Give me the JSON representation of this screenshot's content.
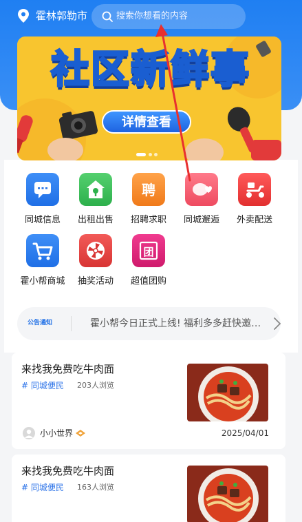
{
  "header": {
    "city": "霍林郭勒市",
    "search_placeholder": "搜索你想看的内容"
  },
  "banner": {
    "title": "社区新鲜事",
    "button_label": "详情查看",
    "colors": {
      "background": "#f8c52f",
      "title_fill": "#e6f1ff",
      "title_stroke": "#1a5ed1",
      "button": "#2f7af0"
    }
  },
  "categories": [
    {
      "label": "同城信息",
      "icon": "chat-bubble-icon",
      "color": "#2d7df0"
    },
    {
      "label": "出租出售",
      "icon": "house-icon",
      "color": "#39c15a"
    },
    {
      "label": "招聘求职",
      "icon": "hire-icon",
      "color": "#f58a2c"
    },
    {
      "label": "同城邂逅",
      "icon": "heart-chat-icon",
      "color": "#f15b6c"
    },
    {
      "label": "外卖配送",
      "icon": "scooter-icon",
      "color": "#ef3b3b"
    },
    {
      "label": "霍小帮商城",
      "icon": "cart-icon",
      "color": "#1f6fe6"
    },
    {
      "label": "抽奖活动",
      "icon": "wheel-icon",
      "color": "#e8403f"
    },
    {
      "label": "超值团购",
      "icon": "group-buy-icon",
      "color": "#e0237d"
    }
  ],
  "notice": {
    "badge": "公告通知",
    "text": "霍小帮今日正式上线! 福利多多赶快邀请好友"
  },
  "posts": [
    {
      "title": "来找我免费吃牛肉面",
      "tag": "# 同城便民",
      "views": "203人浏览",
      "author": "小小世界",
      "date": "2025/04/01"
    },
    {
      "title": "来找我免费吃牛肉面",
      "tag": "# 同城便民",
      "views": "163人浏览"
    }
  ],
  "accent_colors": {
    "primary_blue": "#1f7ff2",
    "annotation_red": "#e8302f"
  }
}
